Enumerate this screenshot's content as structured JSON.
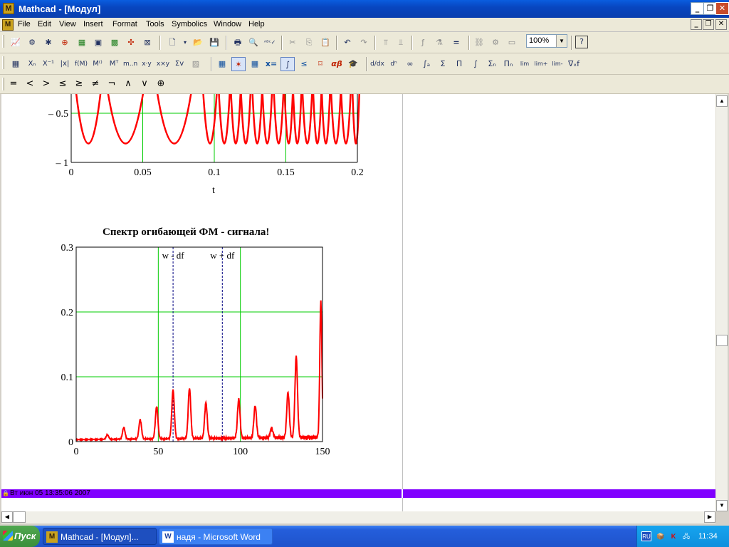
{
  "window": {
    "title": "Mathcad - [Модул]",
    "app_icon": "M"
  },
  "menubar": {
    "items": [
      "File",
      "Edit",
      "View",
      "Insert",
      "Format",
      "Tools",
      "Symbolics",
      "Window",
      "Help"
    ]
  },
  "toolbar_standard": {
    "zoom_value": "100%"
  },
  "operator_toolbar": {
    "symbols": [
      "=",
      "<",
      ">",
      "≤",
      "≥",
      "≠",
      "¬",
      "∧",
      "∨",
      "⊕"
    ]
  },
  "icons": {
    "minimize": "minimize-icon",
    "restore": "restore-icon",
    "close": "close-icon",
    "lock": "lock-icon"
  },
  "colors": {
    "trace": "#ff0000",
    "grid": "#00cc00",
    "marker": "#000080",
    "footer_bar": "#8000ff",
    "titlebar": "#0a5ddf"
  },
  "chart_data": [
    {
      "type": "line",
      "title": "",
      "xlabel": "t",
      "ylabel": "",
      "x_ticks": [
        "0",
        "0.05",
        "0.1",
        "0.15",
        "0.2"
      ],
      "y_ticks": [
        "– 0.5",
        "– 1"
      ],
      "xlim": [
        0,
        0.2
      ],
      "ylim": [
        -1,
        -0.5
      ],
      "grid": true,
      "description_series": "FM signal cos(phase), oscillation frequency increasing with t",
      "minima_t": [
        0.012,
        0.038,
        0.072,
        0.097,
        0.107,
        0.115,
        0.122,
        0.13,
        0.137,
        0.145,
        0.152,
        0.158,
        0.165,
        0.172,
        0.178,
        0.185,
        0.192,
        0.199
      ]
    },
    {
      "type": "line",
      "title": "Спектр огибающей ФМ - сигнала!",
      "xlabel": "",
      "ylabel": "",
      "x_ticks": [
        "0",
        "50",
        "100",
        "150"
      ],
      "y_ticks": [
        "0",
        "0.1",
        "0.2",
        "0.3"
      ],
      "xlim": [
        0,
        150
      ],
      "ylim": [
        0,
        0.3
      ],
      "grid": true,
      "markers": [
        {
          "label": "w - df",
          "x": 59
        },
        {
          "label": "w + df",
          "x": 89
        }
      ],
      "peaks": [
        {
          "x": 19,
          "y": 0.007
        },
        {
          "x": 29,
          "y": 0.018
        },
        {
          "x": 39,
          "y": 0.03
        },
        {
          "x": 49,
          "y": 0.05
        },
        {
          "x": 59,
          "y": 0.075
        },
        {
          "x": 69,
          "y": 0.078
        },
        {
          "x": 79,
          "y": 0.055
        },
        {
          "x": 99,
          "y": 0.06
        },
        {
          "x": 109,
          "y": 0.05
        },
        {
          "x": 119,
          "y": 0.015
        },
        {
          "x": 129,
          "y": 0.07
        },
        {
          "x": 134,
          "y": 0.125
        },
        {
          "x": 149,
          "y": 0.21
        }
      ]
    }
  ],
  "footer": {
    "text": "Вт июн 05 13:35:06 2007"
  },
  "taskbar": {
    "start_label": "Пуск",
    "tasks": [
      {
        "label": "Mathcad - [Модул]...",
        "icon": "M"
      },
      {
        "label": "надя - Microsoft Word",
        "icon": "W"
      }
    ],
    "tray": {
      "lang": "RU",
      "clock": "11:34"
    }
  }
}
